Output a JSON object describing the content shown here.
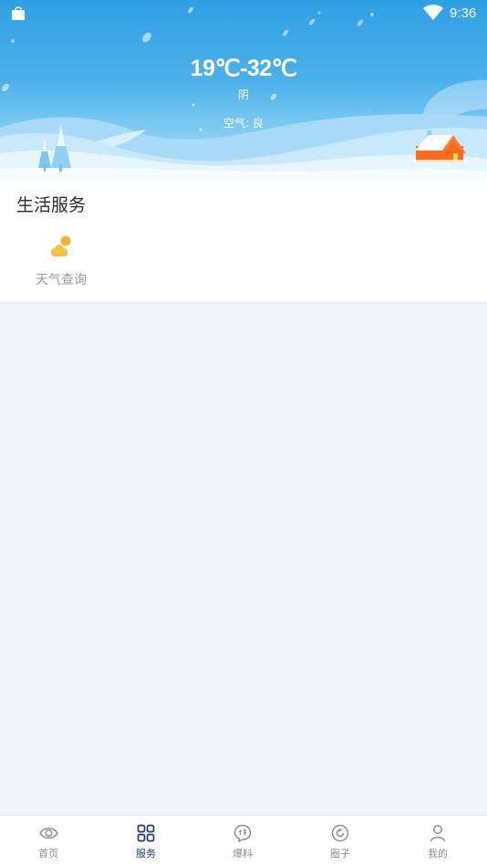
{
  "status_bar": {
    "time": "9:36",
    "left_icon": "shopping-bag-icon",
    "right_icon": "wifi-icon"
  },
  "weather": {
    "temperature_range": "19℃-32℃",
    "condition": "阴",
    "air_quality": "空气: 良"
  },
  "services": {
    "title": "生活服务",
    "items": [
      {
        "label": "天气查询",
        "icon": "weather-cloud-sun-icon",
        "icon_color": "#f5b52d"
      }
    ]
  },
  "bottom_nav": {
    "items": [
      {
        "label": "首页",
        "icon": "eye-icon"
      },
      {
        "label": "服务",
        "icon": "grid-icon"
      },
      {
        "label": "爆料",
        "icon": "chat-bubble-icon"
      },
      {
        "label": "圈子",
        "icon": "circle-refresh-icon"
      },
      {
        "label": "我的",
        "icon": "person-icon"
      }
    ],
    "active_index": 1
  },
  "colors": {
    "sky_top": "#2fa0e4",
    "sky_bottom": "#b8e3fa",
    "house_roof": "#ff6a1a",
    "nav_active": "#1c3b70",
    "nav_inactive": "#8e8e8e",
    "page_background": "#f0f4f8"
  }
}
